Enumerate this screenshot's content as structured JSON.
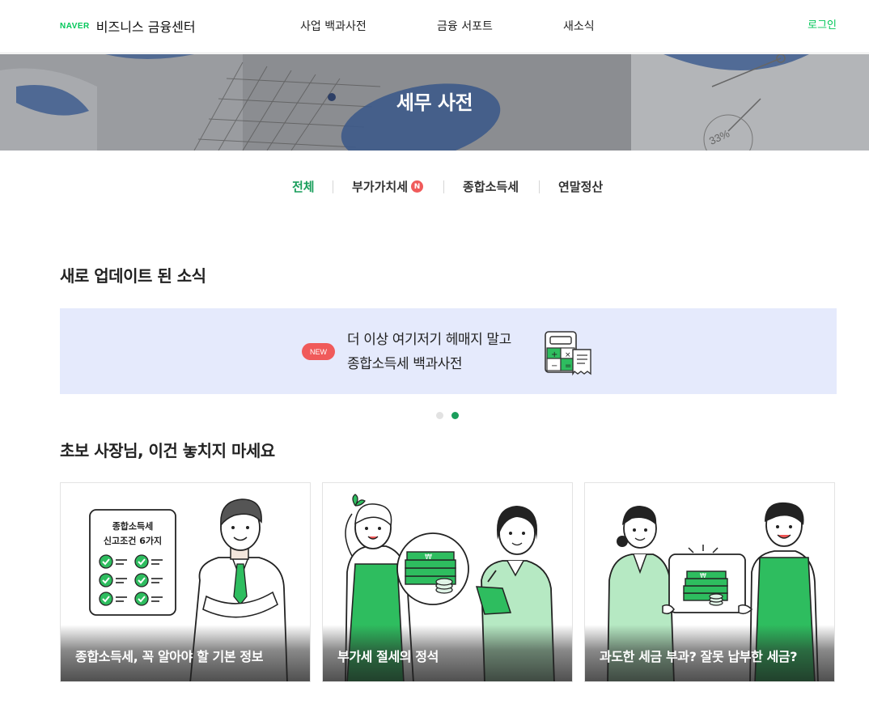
{
  "header": {
    "logo_brand": "NAVER",
    "logo_title": "비즈니스 금융센터",
    "nav": [
      {
        "label": "사업 백과사전"
      },
      {
        "label": "금융 서포트"
      },
      {
        "label": "새소식"
      }
    ],
    "login_label": "로그인"
  },
  "hero": {
    "title": "세무 사전",
    "background_text": "33%"
  },
  "tabs": [
    {
      "label": "전체",
      "active": true
    },
    {
      "label": "부가가치세",
      "badge": "N"
    },
    {
      "label": "종합소득세"
    },
    {
      "label": "연말정산"
    }
  ],
  "news_section": {
    "title": "새로 업데이트 된 소식",
    "banner": {
      "badge": "NEW",
      "line1": "더 이상 여기저기 헤매지 말고",
      "line2": "종합소득세 백과사전",
      "icon": "calculator-receipt-icon"
    },
    "carousel": {
      "total": 2,
      "current": 2
    }
  },
  "beginner_section": {
    "title": "초보 사장님, 이건 놓치지 마세요",
    "cards": [
      {
        "title": "종합소득세, 꼭 알아야 할 기본 정보",
        "board_line1": "종합소득세",
        "board_line2": "신고조건 6가지"
      },
      {
        "title": "부가세 절세의 정석",
        "money_label": "₩"
      },
      {
        "title": "과도한 세금 부과? 잘못 납부한 세금?",
        "money_label": "₩"
      }
    ]
  },
  "colors": {
    "brand_green": "#03c75a",
    "active_tab": "#1a9e5c",
    "badge_red": "#f05a5a",
    "banner_bg": "#e5eafc"
  }
}
